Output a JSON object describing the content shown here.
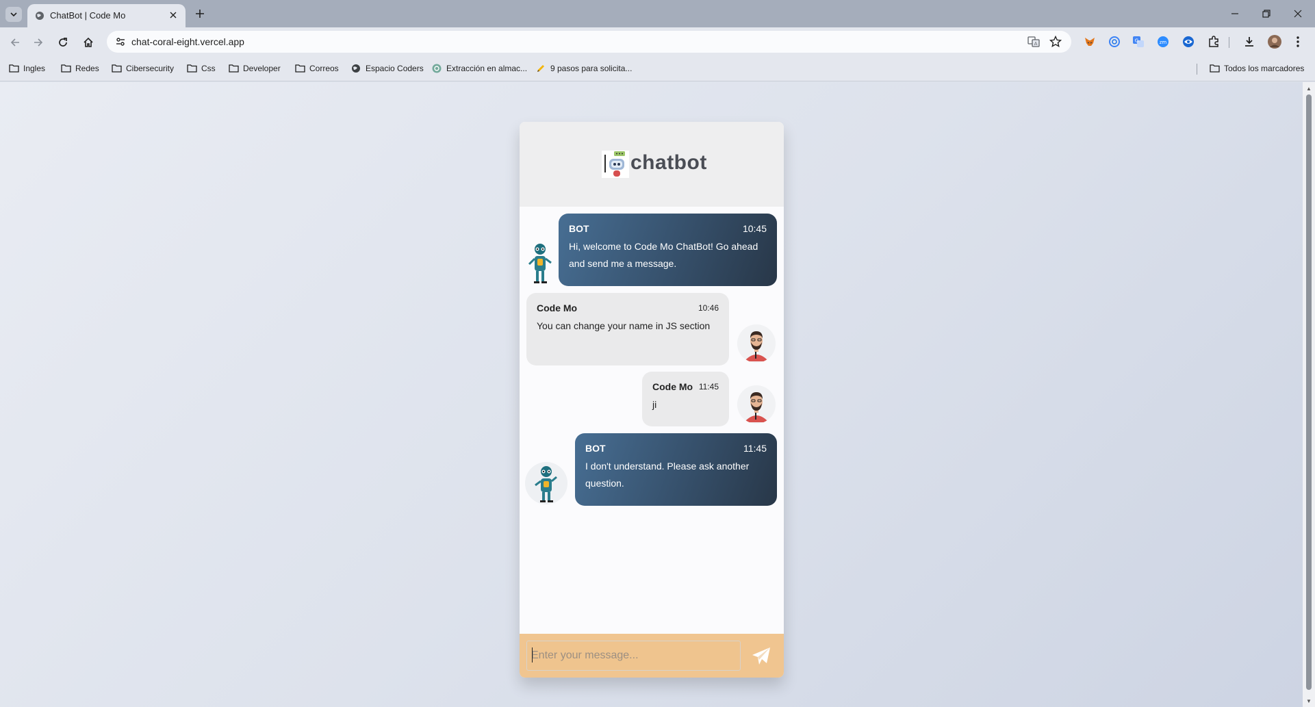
{
  "browser": {
    "tab_title": "ChatBot | Code Mo",
    "url": "chat-coral-eight.vercel.app",
    "bookmarks": [
      {
        "label": "Ingles",
        "icon": "folder-icon"
      },
      {
        "label": "Redes",
        "icon": "folder-icon"
      },
      {
        "label": "Cibersecurity",
        "icon": "folder-icon"
      },
      {
        "label": "Css",
        "icon": "folder-icon"
      },
      {
        "label": "Developer",
        "icon": "folder-icon"
      },
      {
        "label": "Correos",
        "icon": "folder-icon"
      },
      {
        "label": "Espacio Coders",
        "icon": "globe-icon"
      },
      {
        "label": "Extracción en almac...",
        "icon": "openai-icon"
      },
      {
        "label": "9 pasos para solicita...",
        "icon": "pencil-icon"
      }
    ],
    "all_bookmarks_label": "Todos los marcadores"
  },
  "chat": {
    "brand": "chatbot",
    "messages": [
      {
        "role": "bot",
        "sender": "BOT",
        "time": "10:45",
        "text": "Hi, welcome to Code Mo ChatBot! Go ahead and send me a message."
      },
      {
        "role": "user",
        "sender": "Code Mo",
        "time": "10:46",
        "text": "You can change your name in JS section"
      },
      {
        "role": "user",
        "sender": "Code Mo",
        "time": "11:45",
        "text": "ji"
      },
      {
        "role": "bot",
        "sender": "BOT",
        "time": "11:45",
        "text": "I don't understand. Please ask another question."
      }
    ],
    "input_placeholder": "Enter your message...",
    "input_value": "",
    "colors": {
      "bot_bubble_start": "#476e93",
      "bot_bubble_end": "#283748",
      "user_bubble": "#eaeaeb",
      "input_bar": "#f0c590"
    }
  }
}
